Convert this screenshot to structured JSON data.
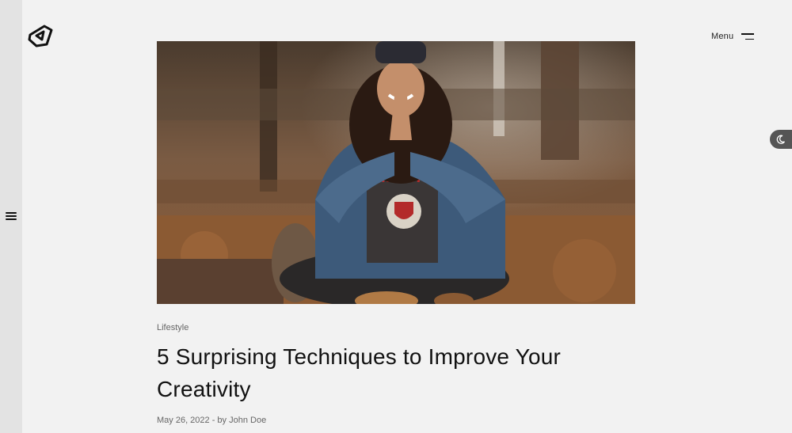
{
  "sidebar": {
    "toggle_icon": "hamburger-icon"
  },
  "header": {
    "logo_icon": "brand-logo",
    "menu_label": "Menu",
    "menu_icon": "menu-lines-icon"
  },
  "theme_toggle": {
    "icon": "moon-icon"
  },
  "article": {
    "category": "Lifestyle",
    "title": "5 Surprising Techniques to Improve Your Creativity",
    "date": "May 26, 2022",
    "byline_separator": " - by ",
    "author": "John Doe"
  },
  "colors": {
    "background": "#f2f2f2",
    "sidebar": "#e3e3e3",
    "toggle": "#555555",
    "text": "#111111",
    "muted": "#666666"
  }
}
